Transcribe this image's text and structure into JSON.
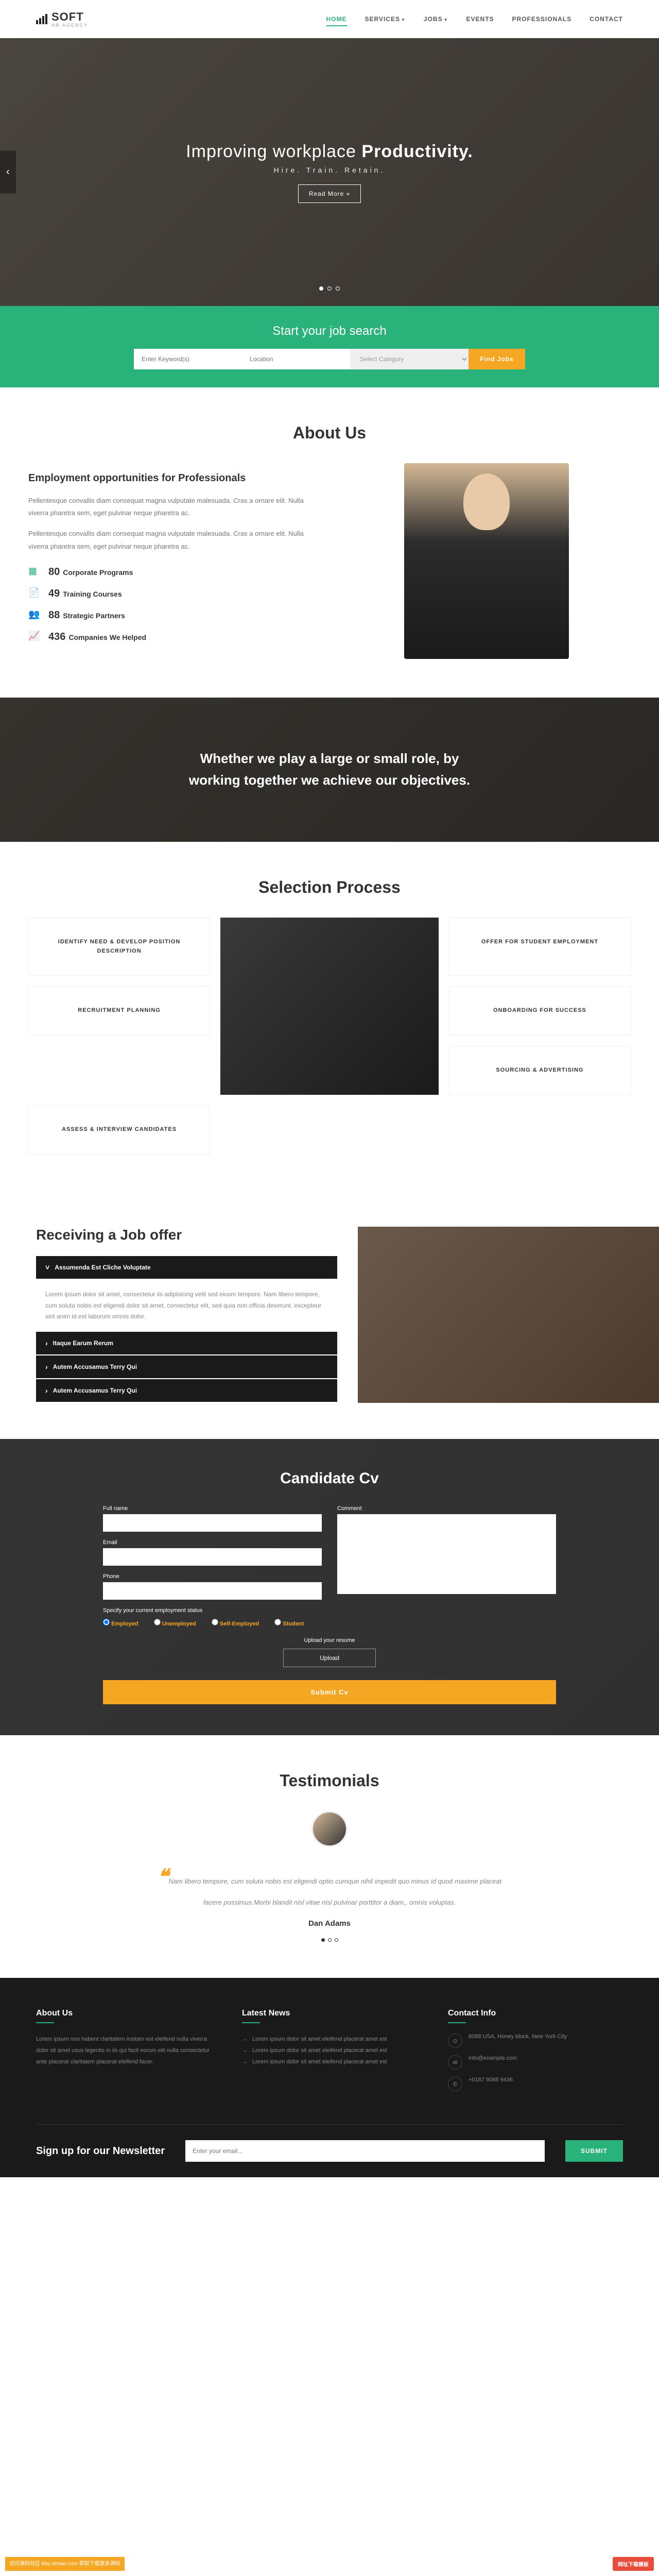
{
  "logo": {
    "text": "SOFT",
    "sub": "HR AGENCY"
  },
  "nav": [
    "HOME",
    "SERVICES",
    "JOBS",
    "EVENTS",
    "PROFESSIONALS",
    "CONTACT"
  ],
  "hero": {
    "title_light": "Improving workplace",
    "title_bold": "Productivity.",
    "sub": "Hire. Train. Retain.",
    "btn": "Read More »"
  },
  "search": {
    "title": "Start your job search",
    "kw_ph": "Enter Keyword(s)",
    "loc_ph": "Location",
    "cat_ph": "Select Category",
    "btn": "Find Jobs"
  },
  "about": {
    "title": "About Us",
    "subtitle": "Employment opportunities for Professionals",
    "p1": "Pellentesque convallis diam consequat magna vulputate malesuada. Cras a ornare elit. Nulla viverra pharetra sem, eget pulvinar neque pharetra ac.",
    "p2": "Pellentesque convallis diam consequat magna vulputate malesuada. Cras a ornare elit. Nulla viverra pharetra sem, eget pulvinar neque pharetra ac.",
    "stats": [
      {
        "icon": "▦",
        "num": "80",
        "label": "Corporate Programs"
      },
      {
        "icon": "📄",
        "num": "49",
        "label": "Training Courses"
      },
      {
        "icon": "👥",
        "num": "88",
        "label": "Strategic Partners"
      },
      {
        "icon": "📈",
        "num": "436",
        "label": "Companies We Helped"
      }
    ]
  },
  "banner": "Whether we play a large or small role, by working together we achieve our objectives.",
  "process": {
    "title": "Selection Process",
    "boxes": [
      "IDENTIFY NEED & DEVELOP POSITION DESCRIPTION",
      "RECRUITMENT PLANNING",
      "SOURCING & ADVERTISING",
      "ASSESS & INTERVIEW CANDIDATES",
      "OFFER FOR STUDENT EMPLOYMENT",
      "ONBOARDING FOR SUCCESS"
    ]
  },
  "offer": {
    "title": "Receiving a Job offer",
    "items": [
      {
        "h": "Assumenda Est Cliche Voluptate",
        "open": true,
        "body": "Lorem ipsum dolor sit amet, consectetur iis adipisicing velit sed eiusm tempore. Nam libero tempore, cum soluta nobis est eligendi dolor sit amet, consectetur elit, sed quia non officia deserunt. excepteur sint anim id est laborum omnis dolor."
      },
      {
        "h": "Itaque Earum Rerum"
      },
      {
        "h": "Autem Accusamus Terry Qui"
      },
      {
        "h": "Autem Accusamus Terry Qui"
      }
    ]
  },
  "cv": {
    "title": "Candidate Cv",
    "labels": {
      "name": "Full name",
      "email": "Email",
      "phone": "Phone",
      "comment": "Comment"
    },
    "radio_label": "Specify your current employment status",
    "radios": [
      "Employed",
      "Unemployed",
      "Self-Employed",
      "Student"
    ],
    "upload_label": "Upload your resume",
    "upload_btn": "Upload",
    "submit": "Submit Cv"
  },
  "testi": {
    "title": "Testimonials",
    "text": "Nam libero tempore, cum soluta nobis est eligendi optio cumque nihil impedit quo minus id quod maxime placeat facere possimus.Morbi blandit nisl vitae nisl pulvinar porttitor a diam,. omnis voluptas.",
    "name": "Dan Adams"
  },
  "footer": {
    "about": {
      "h": "About Us",
      "p": "Lorem ipsum non habent claritatem insitam est eleifend nulla viverra dolor sit amet usus legentis in iis qui facit eorum elit nulla consectetur ante placerat claritatem placerat eleifend facer."
    },
    "news": {
      "h": "Latest News",
      "items": [
        "Lorem ipsum dolor sit amet eleifend placerat amet est",
        "Lorem ipsum dolor sit amet eleifend placerat amet est",
        "Lorem ipsum dolor sit amet eleifend placerat amet est"
      ]
    },
    "contact": {
      "h": "Contact Info",
      "addr": "8088 USA, Honey block, New York City",
      "email": "info@example.com",
      "phone": "+0187 9088 9436"
    },
    "newsletter": {
      "h": "Sign up for our Newsletter",
      "ph": "Enter your email...",
      "btn": "SUBMIT"
    }
  },
  "badges": {
    "left": "访问源码社区 bbs.xtmiao.com 获取下载更多源码",
    "right": "网址下载模板"
  }
}
